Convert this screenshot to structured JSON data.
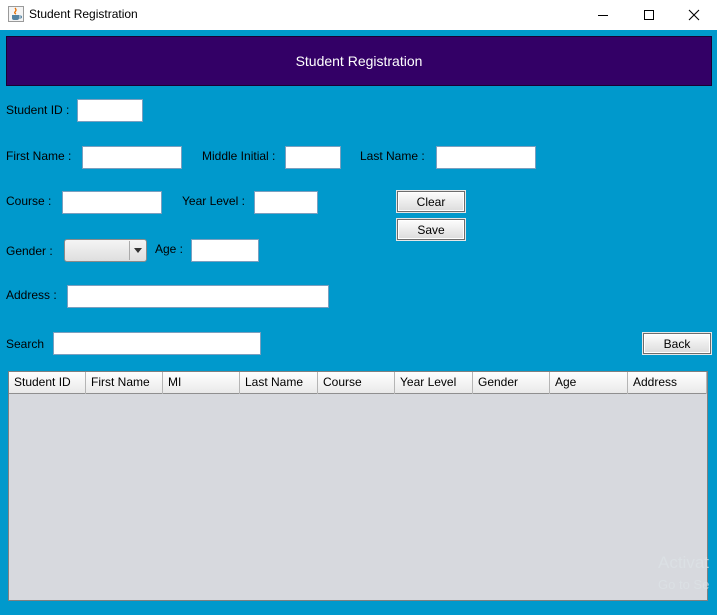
{
  "window": {
    "title": "Student Registration",
    "icon": "java-cup-icon",
    "controls": {
      "minimize_icon": "minimize-icon",
      "maximize_icon": "maximize-icon",
      "close_icon": "close-icon"
    }
  },
  "header": {
    "title": "Student Registration"
  },
  "form": {
    "student_id_label": "Student ID :",
    "first_name_label": "First Name :",
    "middle_initial_label": "Middle Initial :",
    "last_name_label": "Last Name :",
    "course_label": "Course :",
    "year_level_label": "Year Level :",
    "gender_label": "Gender :",
    "gender_value": "",
    "age_label": "Age :",
    "address_label": "Address :",
    "search_label": "Search"
  },
  "buttons": {
    "clear": "Clear",
    "save": "Save",
    "back": "Back"
  },
  "table": {
    "columns": [
      "Student ID",
      "First Name",
      "MI",
      "Last Name",
      "Course",
      "Year Level",
      "Gender",
      "Age",
      "Address"
    ],
    "rows": []
  },
  "watermark": {
    "line1": "Activat",
    "line2": "Go to Se"
  },
  "colors": {
    "background": "#0099cc",
    "header": "#330066",
    "table_body": "#d7d9de"
  }
}
